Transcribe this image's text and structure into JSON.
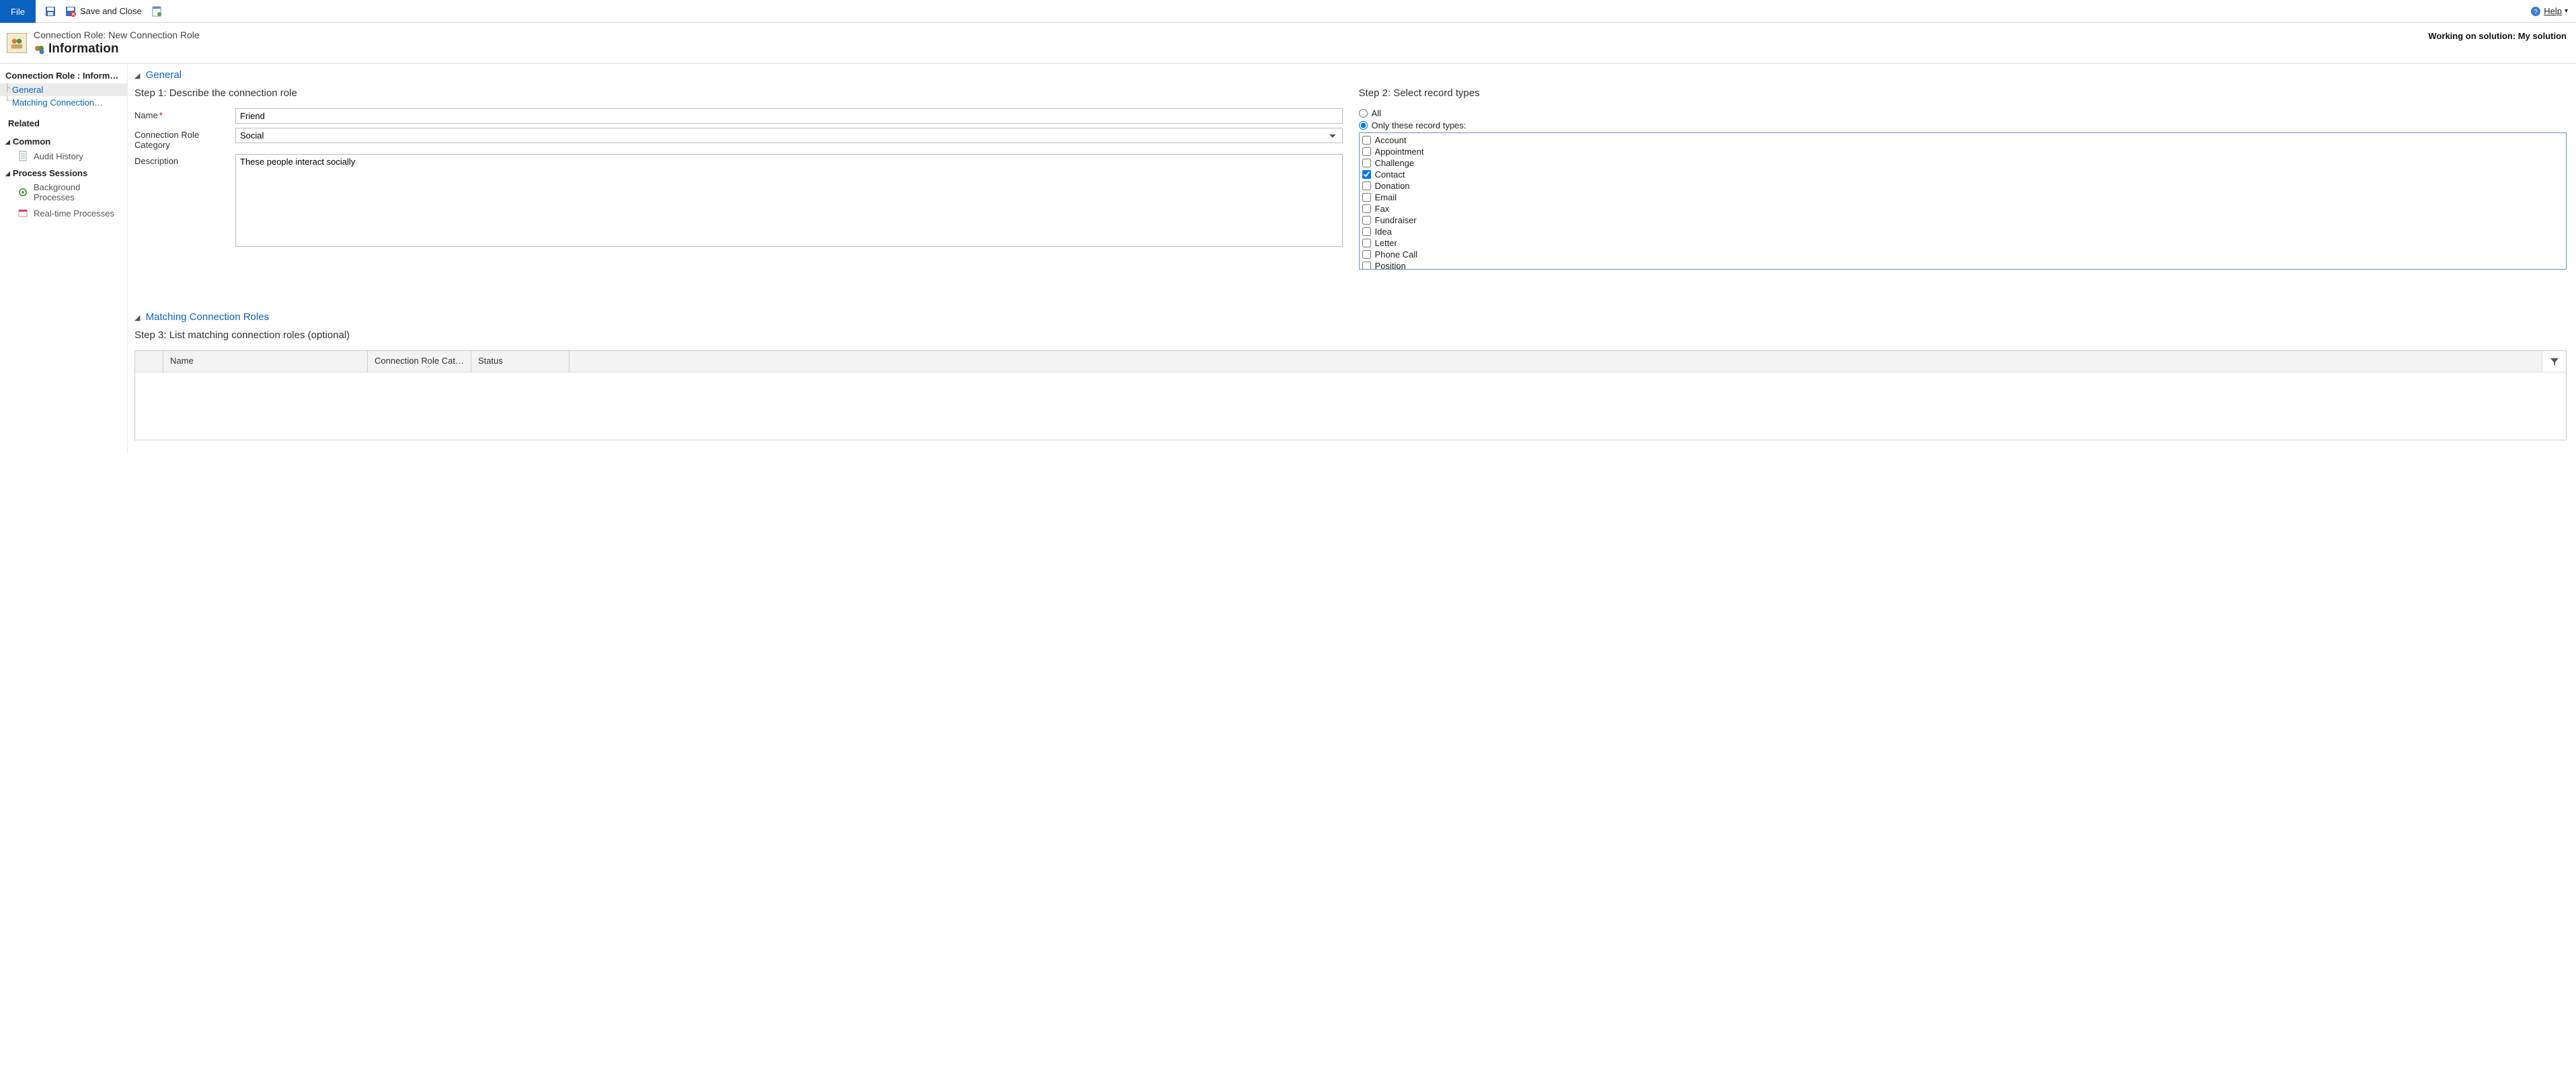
{
  "ribbon": {
    "file": "File",
    "save_close": "Save and Close",
    "help": "Help"
  },
  "header": {
    "breadcrumb": "Connection Role: New Connection Role",
    "title": "Information",
    "working_on": "Working on solution: My solution"
  },
  "sidebar": {
    "title": "Connection Role : Inform…",
    "nav": [
      {
        "label": "General",
        "active": true
      },
      {
        "label": "Matching Connection…",
        "active": false
      }
    ],
    "related": "Related",
    "groups": [
      {
        "label": "Common",
        "items": [
          {
            "label": "Audit History"
          }
        ]
      },
      {
        "label": "Process Sessions",
        "items": [
          {
            "label": "Background Processes"
          },
          {
            "label": "Real-time Processes"
          }
        ]
      }
    ]
  },
  "sections": {
    "general": "General",
    "matching": "Matching Connection Roles"
  },
  "step1": {
    "title": "Step 1: Describe the connection role",
    "name_label": "Name",
    "name_value": "Friend",
    "category_label": "Connection Role Category",
    "category_value": "Social",
    "description_label": "Description",
    "description_value": "These people interact socially"
  },
  "step2": {
    "title": "Step 2: Select record types",
    "all_label": "All",
    "only_label": "Only these record types:",
    "selected_mode": "only",
    "record_types": [
      {
        "label": "Account",
        "checked": false
      },
      {
        "label": "Appointment",
        "checked": false
      },
      {
        "label": "Challenge",
        "checked": false
      },
      {
        "label": "Contact",
        "checked": true
      },
      {
        "label": "Donation",
        "checked": false
      },
      {
        "label": "Email",
        "checked": false
      },
      {
        "label": "Fax",
        "checked": false
      },
      {
        "label": "Fundraiser",
        "checked": false
      },
      {
        "label": "Idea",
        "checked": false
      },
      {
        "label": "Letter",
        "checked": false
      },
      {
        "label": "Phone Call",
        "checked": false
      },
      {
        "label": "Position",
        "checked": false
      }
    ]
  },
  "step3": {
    "title": "Step 3: List matching connection roles (optional)",
    "columns": {
      "name": "Name",
      "category": "Connection Role Cate…",
      "status": "Status"
    }
  }
}
